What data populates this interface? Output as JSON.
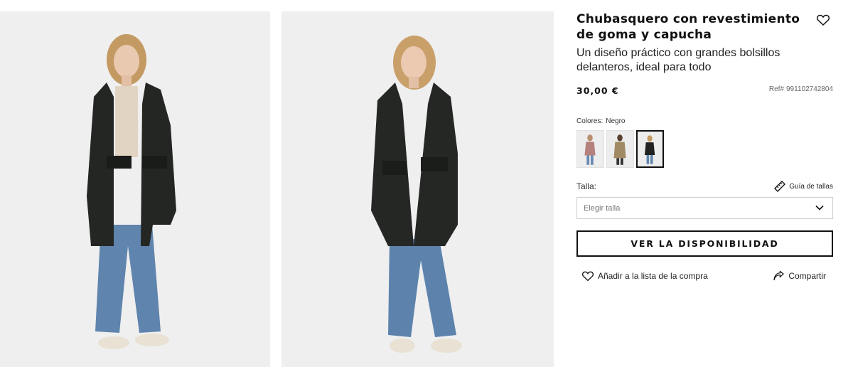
{
  "product": {
    "title": "Chubasquero con revestimiento de goma y capucha",
    "subtitle": "Un diseño práctico con grandes bolsillos delanteros, ideal para todo",
    "price": "30,00 €",
    "ref_label": "Ref#",
    "ref_value": "991102742804"
  },
  "colors": {
    "label": "Colores:",
    "selected": "Negro",
    "swatches": [
      {
        "color": "#b5817d",
        "name": "swatch-pink"
      },
      {
        "color": "#a08a64",
        "name": "swatch-beige"
      },
      {
        "color": "#222222",
        "name": "swatch-black",
        "selected": true
      }
    ]
  },
  "size": {
    "label": "Talla:",
    "guide_label": "Guía de tallas",
    "select_placeholder": "Elegir talla"
  },
  "buttons": {
    "availability": "VER LA DISPONIBILIDAD",
    "add_to_list": "Añadir a la lista de la compra",
    "share": "Compartir"
  }
}
